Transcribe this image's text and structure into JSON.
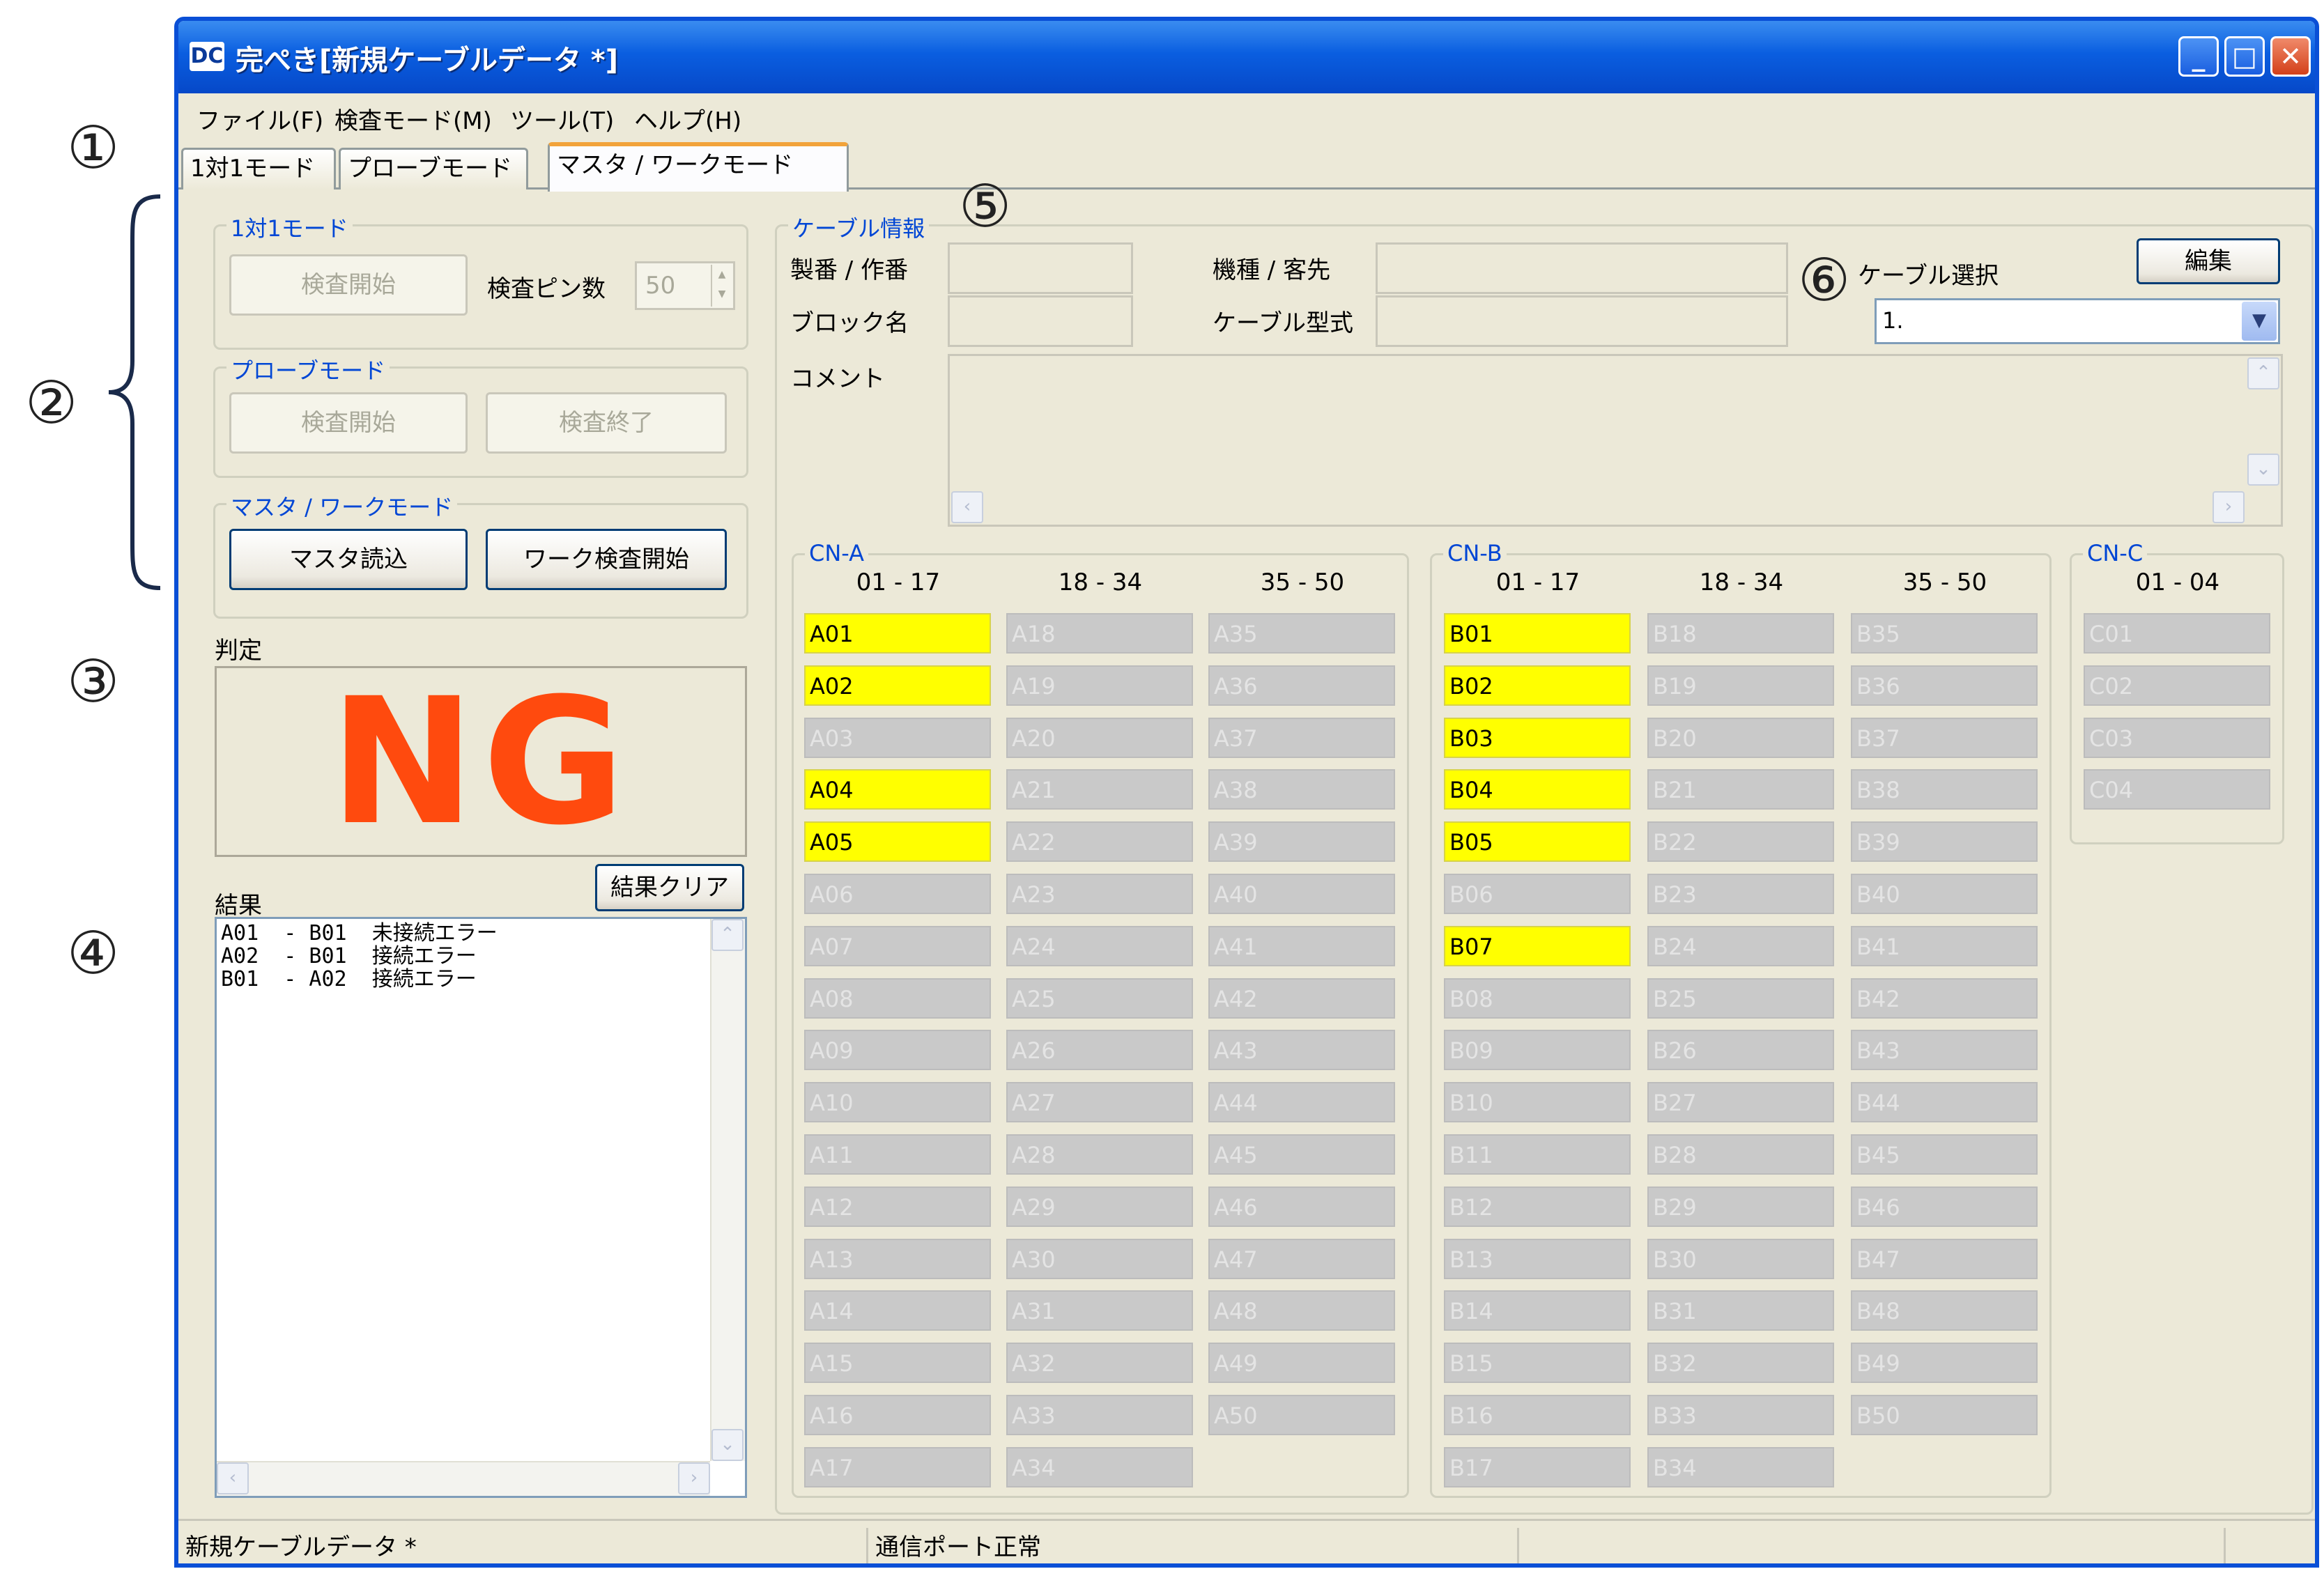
{
  "annotations": [
    "①",
    "②",
    "③",
    "④",
    "⑤",
    "⑥"
  ],
  "window": {
    "icon_text": "DC",
    "title": "完ぺき[新規ケーブルデータ *]",
    "minimize": "_",
    "maximize": "□",
    "close": "✕"
  },
  "menu": [
    "ファイル(F)",
    "検査モード(M)",
    "ツール(T)",
    "ヘルプ(H)"
  ],
  "tabs": [
    "1対1モード",
    "プローブモード",
    "マスタ / ワークモード"
  ],
  "active_tab": 2,
  "one_to_one": {
    "group_title": "1対1モード",
    "start_label": "検査開始",
    "pin_count_label": "検査ピン数",
    "pin_count_value": "50"
  },
  "probe": {
    "group_title": "プローブモード",
    "start_label": "検査開始",
    "end_label": "検査終了"
  },
  "master_work": {
    "group_title": "マスタ / ワークモード",
    "master_read_label": "マスタ読込",
    "work_start_label": "ワーク検査開始"
  },
  "judgement": {
    "label": "判定",
    "value": "NG",
    "color": "#ff4a0e"
  },
  "result": {
    "label": "結果",
    "clear_label": "結果クリア",
    "lines": [
      "A01  - B01  未接続エラー",
      "A02  - B01  接続エラー",
      "B01  - A02  接続エラー"
    ]
  },
  "cable_info": {
    "group_title": "ケーブル情報",
    "serial_label": "製番 / 作番",
    "model_label": "機種 / 客先",
    "block_label": "ブロック名",
    "cable_type_label": "ケーブル型式",
    "comment_label": "コメント",
    "cable_select_label": "ケーブル選択",
    "cable_select_value": "1.",
    "edit_label": "編集"
  },
  "connectors": {
    "cn_a": {
      "title": "CN-A",
      "columns": [
        {
          "header": "01 - 17",
          "pins": [
            "A01",
            "A02",
            "A03",
            "A04",
            "A05",
            "A06",
            "A07",
            "A08",
            "A09",
            "A10",
            "A11",
            "A12",
            "A13",
            "A14",
            "A15",
            "A16",
            "A17"
          ]
        },
        {
          "header": "18 - 34",
          "pins": [
            "A18",
            "A19",
            "A20",
            "A21",
            "A22",
            "A23",
            "A24",
            "A25",
            "A26",
            "A27",
            "A28",
            "A29",
            "A30",
            "A31",
            "A32",
            "A33",
            "A34"
          ]
        },
        {
          "header": "35 - 50",
          "pins": [
            "A35",
            "A36",
            "A37",
            "A38",
            "A39",
            "A40",
            "A41",
            "A42",
            "A43",
            "A44",
            "A45",
            "A46",
            "A47",
            "A48",
            "A49",
            "A50"
          ]
        }
      ],
      "active": [
        "A01",
        "A02",
        "A04",
        "A05"
      ]
    },
    "cn_b": {
      "title": "CN-B",
      "columns": [
        {
          "header": "01 - 17",
          "pins": [
            "B01",
            "B02",
            "B03",
            "B04",
            "B05",
            "B06",
            "B07",
            "B08",
            "B09",
            "B10",
            "B11",
            "B12",
            "B13",
            "B14",
            "B15",
            "B16",
            "B17"
          ]
        },
        {
          "header": "18 - 34",
          "pins": [
            "B18",
            "B19",
            "B20",
            "B21",
            "B22",
            "B23",
            "B24",
            "B25",
            "B26",
            "B27",
            "B28",
            "B29",
            "B30",
            "B31",
            "B32",
            "B33",
            "B34"
          ]
        },
        {
          "header": "35 - 50",
          "pins": [
            "B35",
            "B36",
            "B37",
            "B38",
            "B39",
            "B40",
            "B41",
            "B42",
            "B43",
            "B44",
            "B45",
            "B46",
            "B47",
            "B48",
            "B49",
            "B50"
          ]
        }
      ],
      "active": [
        "B01",
        "B02",
        "B03",
        "B04",
        "B05",
        "B07"
      ]
    },
    "cn_c": {
      "title": "CN-C",
      "columns": [
        {
          "header": "01 - 04",
          "pins": [
            "C01",
            "C02",
            "C03",
            "C04"
          ]
        }
      ],
      "active": []
    }
  },
  "status": {
    "file": "新規ケーブルデータ *",
    "port": "通信ポート正常"
  },
  "colors": {
    "pin_active": "#ffff00",
    "pin_inactive": "#c9c9c9",
    "group_title": "#0046d5",
    "window_frame": "#0a4fd6"
  }
}
